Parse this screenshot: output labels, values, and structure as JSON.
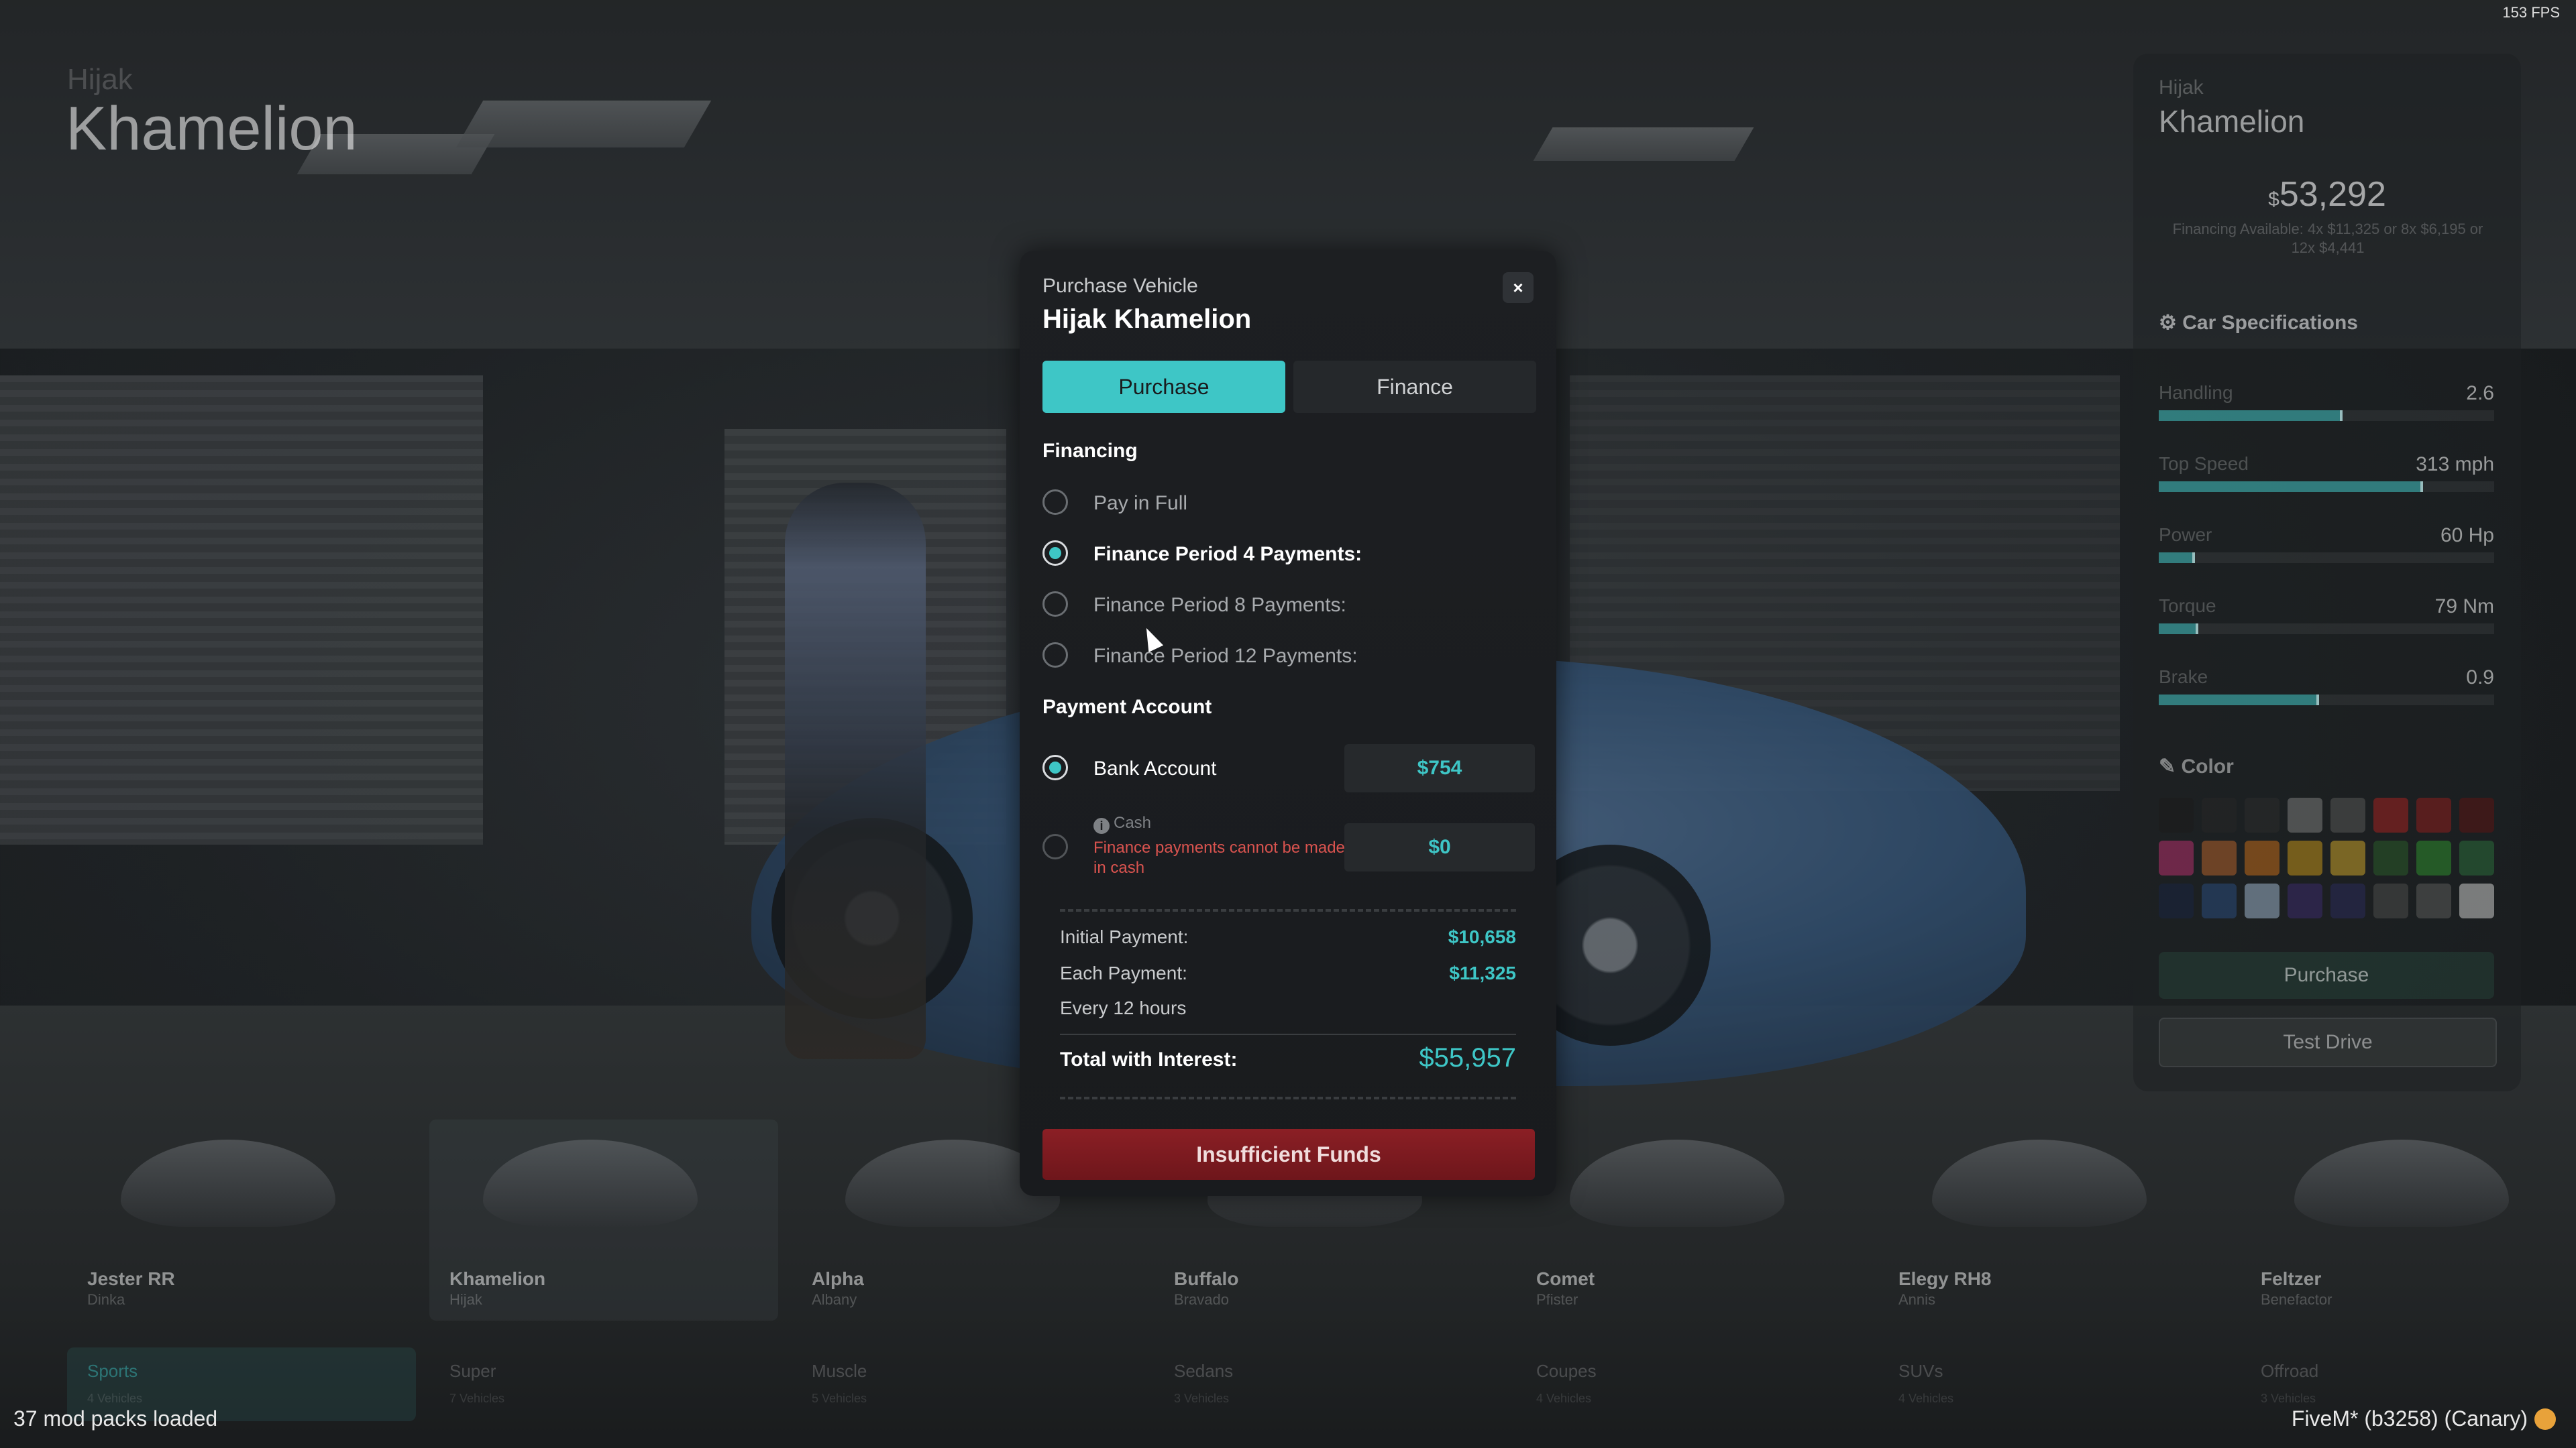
{
  "hud": {
    "fps": "153 FPS",
    "mod_packs": "37 mod packs loaded",
    "fivem": "FiveM* (b3258) (Canary)"
  },
  "background": {
    "brand": "Hijak",
    "model": "Khamelion"
  },
  "right_panel": {
    "brand": "Hijak",
    "model": "Khamelion",
    "price_symbol": "$",
    "price": "53,292",
    "financing_text": "Financing Available: 4x $11,325 or 8x $6,195 or 12x $4,441",
    "specs_title": "Car Specifications",
    "specs": [
      {
        "name": "Handling",
        "value": "2.6",
        "level": 0.54
      },
      {
        "name": "Top Speed",
        "value": "313 mph",
        "level": 0.78
      },
      {
        "name": "Power",
        "value": "60 Hp",
        "level": 0.1
      },
      {
        "name": "Torque",
        "value": "79 Nm",
        "level": 0.11
      },
      {
        "name": "Brake",
        "value": "0.9",
        "level": 0.47
      }
    ],
    "color_title": "Color",
    "swatches": [
      "#1b1b1b",
      "#262626",
      "#2b2b2b",
      "#7a7a7a",
      "#555555",
      "#a02020",
      "#8a1d1d",
      "#5a1414",
      "#b0306a",
      "#b0602a",
      "#c06a1a",
      "#c0901a",
      "#c8a02a",
      "#2a5a2a",
      "#2e8a2e",
      "#2a6a3a",
      "#1a2440",
      "#2a4a7a",
      "#9ab0c8",
      "#3a2a6a",
      "#2a2a5a",
      "#4a4a4a",
      "#5a5a5a",
      "#c8c8c8"
    ],
    "purchase_label": "Purchase",
    "test_drive_label": "Test Drive"
  },
  "car_list": [
    {
      "name": "Jester RR",
      "make": "Dinka"
    },
    {
      "name": "Khamelion",
      "make": "Hijak"
    },
    {
      "name": "Alpha",
      "make": "Albany"
    },
    {
      "name": "Buffalo",
      "make": "Bravado"
    },
    {
      "name": "Comet",
      "make": "Pfister"
    },
    {
      "name": "Elegy RH8",
      "make": "Annis"
    },
    {
      "name": "Feltzer",
      "make": "Benefactor"
    }
  ],
  "categories": [
    {
      "name": "Sports",
      "count": "4 Vehicles"
    },
    {
      "name": "Super",
      "count": "7 Vehicles"
    },
    {
      "name": "Muscle",
      "count": "5 Vehicles"
    },
    {
      "name": "Sedans",
      "count": "3 Vehicles"
    },
    {
      "name": "Coupes",
      "count": "4 Vehicles"
    },
    {
      "name": "SUVs",
      "count": "4 Vehicles"
    },
    {
      "name": "Offroad",
      "count": "3 Vehicles"
    }
  ],
  "modal": {
    "subtitle": "Purchase Vehicle",
    "title": "Hijak Khamelion",
    "close": "×",
    "tabs": {
      "purchase": "Purchase",
      "finance": "Finance"
    },
    "financing_heading": "Financing",
    "financing_options": [
      {
        "label": "Pay in Full",
        "selected": false
      },
      {
        "label": "Finance Period 4 Payments:",
        "selected": true
      },
      {
        "label": "Finance Period 8 Payments:",
        "selected": false
      },
      {
        "label": "Finance Period 12 Payments:",
        "selected": false
      }
    ],
    "payment_heading": "Payment Account",
    "bank": {
      "label": "Bank Account",
      "amount": "$754",
      "selected": true
    },
    "cash": {
      "label": "Cash",
      "info_icon": "i",
      "warning": "Finance payments cannot be made in cash",
      "amount": "$0",
      "selected": false
    },
    "summary": {
      "initial_label": "Initial Payment:",
      "initial_value": "$10,658",
      "each_label": "Each Payment:",
      "each_value": "$11,325",
      "interval": "Every 12 hours",
      "total_label": "Total with Interest:",
      "total_value": "$55,957"
    },
    "action_label": "Insufficient Funds"
  }
}
